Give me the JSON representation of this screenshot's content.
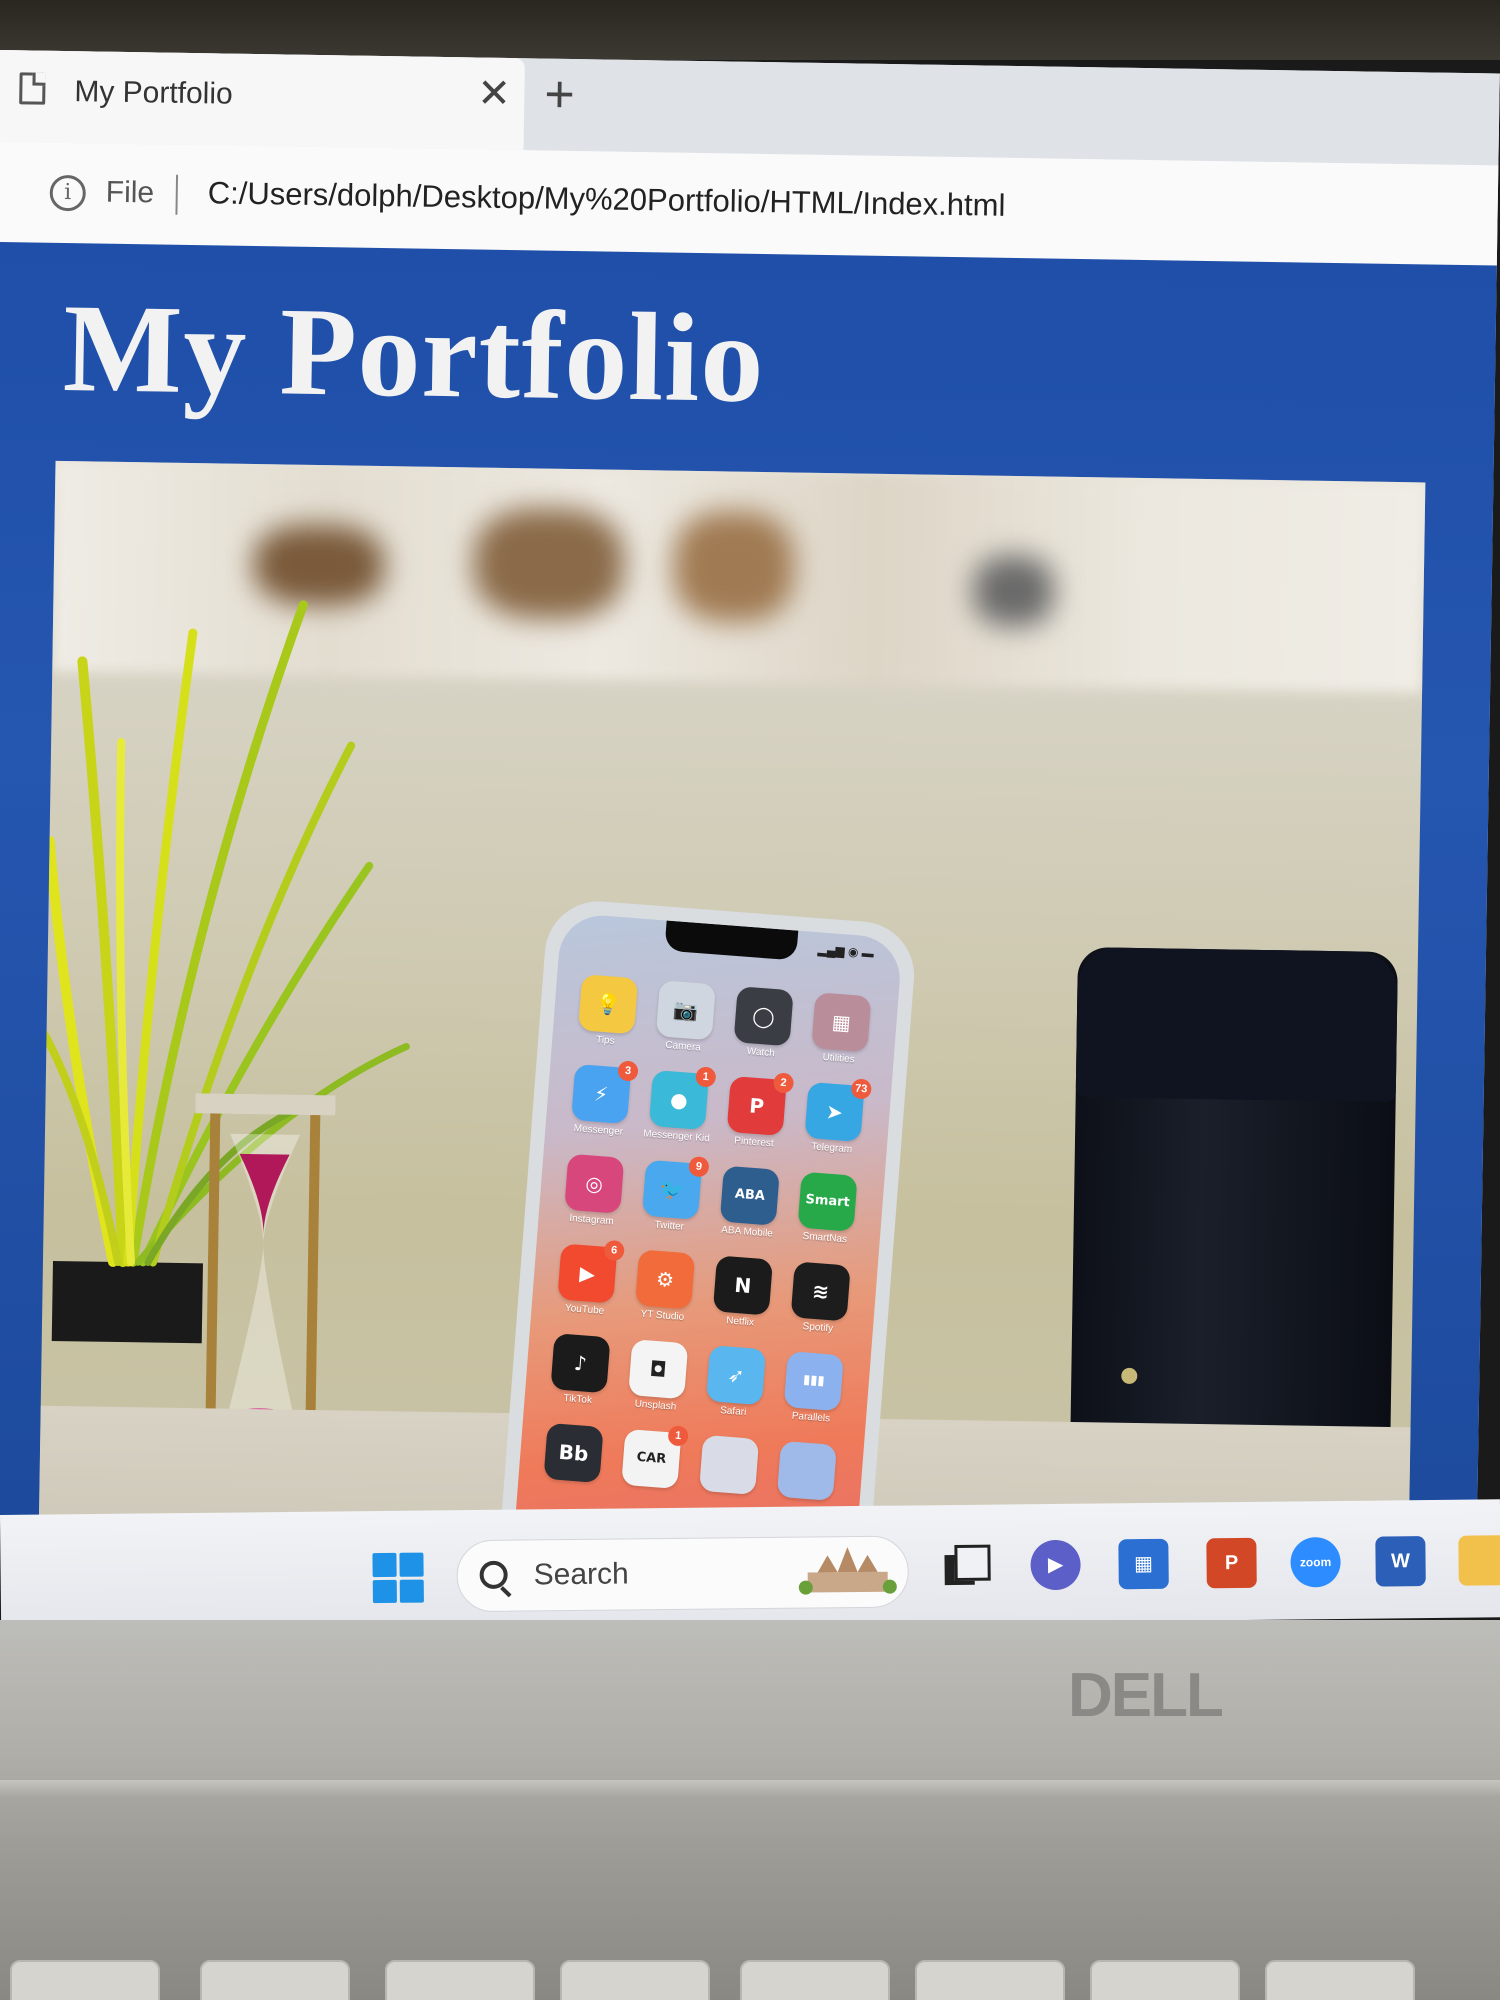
{
  "browser": {
    "tab_title": "My Portfolio",
    "close_glyph": "✕",
    "new_tab_glyph": "+",
    "info_glyph": "i",
    "scheme_label": "File",
    "url": "C:/Users/dolph/Desktop/My%20Portfolio/HTML/Index.html"
  },
  "page": {
    "title": "My Portfolio",
    "background_color": "#2351a6"
  },
  "phone_apps": [
    {
      "label": "Tips",
      "icon": "lightbulb-icon",
      "glyph": "💡",
      "color": "#f5c842",
      "badge": ""
    },
    {
      "label": "Camera",
      "icon": "camera-icon",
      "glyph": "📷",
      "color": "#cfd6df",
      "badge": ""
    },
    {
      "label": "Watch",
      "icon": "watch-icon",
      "glyph": "◯",
      "color": "#3a3d44",
      "badge": ""
    },
    {
      "label": "Utilities",
      "icon": "folder-icon",
      "glyph": "▦",
      "color": "#b98d9a",
      "badge": ""
    },
    {
      "label": "Messenger",
      "icon": "messenger-icon",
      "glyph": "⚡",
      "color": "#4aa3f0",
      "badge": "3"
    },
    {
      "label": "Messenger Kids",
      "icon": "messenger-kids-icon",
      "glyph": "●",
      "color": "#3ab9d8",
      "badge": "1"
    },
    {
      "label": "Pinterest",
      "icon": "pinterest-icon",
      "glyph": "P",
      "color": "#e23b3b",
      "badge": "2"
    },
    {
      "label": "Telegram",
      "icon": "telegram-icon",
      "glyph": "➤",
      "color": "#37a7e3",
      "badge": "73"
    },
    {
      "label": "Instagram",
      "icon": "instagram-icon",
      "glyph": "◎",
      "color": "#d8477b",
      "badge": ""
    },
    {
      "label": "Twitter",
      "icon": "twitter-icon",
      "glyph": "🐦",
      "color": "#4aa8ee",
      "badge": "9"
    },
    {
      "label": "ABA Mobile",
      "icon": "aba-mobile-icon",
      "glyph": "ABA",
      "color": "#2e5e8e",
      "badge": ""
    },
    {
      "label": "SmartNas",
      "icon": "smart-icon",
      "glyph": "Smart",
      "color": "#27a94a",
      "badge": ""
    },
    {
      "label": "YouTube",
      "icon": "youtube-icon",
      "glyph": "▶",
      "color": "#f24a2f",
      "badge": "6"
    },
    {
      "label": "YT Studio",
      "icon": "yt-studio-icon",
      "glyph": "⚙",
      "color": "#f26b3a",
      "badge": ""
    },
    {
      "label": "Netflix",
      "icon": "netflix-icon",
      "glyph": "N",
      "color": "#1b1b1b",
      "badge": ""
    },
    {
      "label": "Spotify",
      "icon": "spotify-icon",
      "glyph": "≋",
      "color": "#1d1d1d",
      "badge": ""
    },
    {
      "label": "TikTok",
      "icon": "tiktok-icon",
      "glyph": "♪",
      "color": "#1b1b1b",
      "badge": ""
    },
    {
      "label": "Unsplash",
      "icon": "unsplash-icon",
      "glyph": "◘",
      "color": "#f4f4f4",
      "badge": ""
    },
    {
      "label": "Safari",
      "icon": "safari-icon",
      "glyph": "➶",
      "color": "#5ab6ef",
      "badge": ""
    },
    {
      "label": "Parallels",
      "icon": "analytics-icon",
      "glyph": "▮▮▮",
      "color": "#8bb2ef",
      "badge": ""
    },
    {
      "label": "",
      "icon": "bb-icon",
      "glyph": "Bb",
      "color": "#2a2d33",
      "badge": ""
    },
    {
      "label": "",
      "icon": "carbuzz-icon",
      "glyph": "CAR",
      "color": "#f3f3f3",
      "badge": "1"
    },
    {
      "label": "",
      "icon": "app-icon",
      "glyph": "",
      "color": "#d9dce6",
      "badge": ""
    },
    {
      "label": "",
      "icon": "app-icon",
      "glyph": "",
      "color": "#9fb9e8",
      "badge": ""
    }
  ],
  "taskbar": {
    "search_placeholder": "Search",
    "apps": [
      {
        "name": "teams-icon",
        "glyph": "▶",
        "color": "#5b5fc7"
      },
      {
        "name": "store-icon",
        "glyph": "▦",
        "color": "#2a6fd1"
      },
      {
        "name": "powerpoint-icon",
        "glyph": "P",
        "color": "#d24726"
      },
      {
        "name": "zoom-icon",
        "glyph": "zoom",
        "color": "#2d8cff"
      },
      {
        "name": "word-icon",
        "glyph": "W",
        "color": "#2b5fb8"
      },
      {
        "name": "file-explorer-icon",
        "glyph": "",
        "color": "#f2c14b"
      }
    ]
  },
  "laptop": {
    "brand": "DELL"
  }
}
